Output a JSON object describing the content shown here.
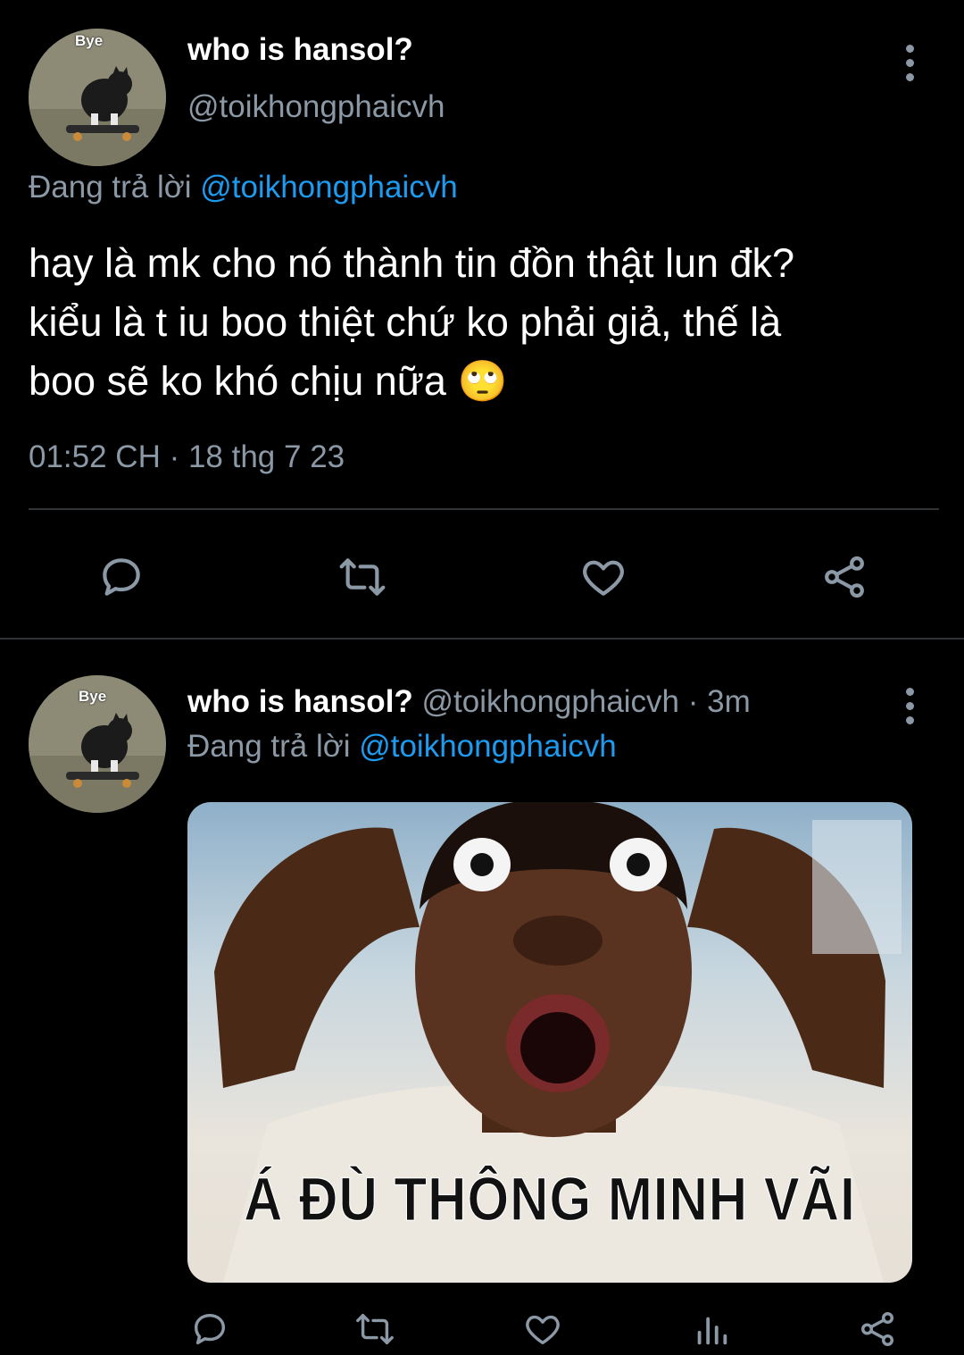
{
  "tweet": {
    "avatar_text": "Bye",
    "display_name": "who is hansol?",
    "handle": "@toikhongphaicvh",
    "replying_prefix": "Đang trả lời",
    "replying_handle": "@toikhongphaicvh",
    "text_line1": "hay là mk cho nó thành tin đồn thật lun đk?",
    "text_line2": "kiểu là t iu boo thiệt chứ ko phải giả, thế là",
    "text_line3": "boo sẽ ko khó chịu nữa",
    "emoji": "🙄",
    "timestamp": "01:52 CH · 18 thg 7 23"
  },
  "reply": {
    "avatar_text": "Bye",
    "display_name": "who is hansol?",
    "handle": "@toikhongphaicvh",
    "time_sep": "·",
    "time": "3m",
    "replying_prefix": "Đang trả lời",
    "replying_handle": "@toikhongphaicvh",
    "meme_caption": "Á ĐÙ THÔNG MINH VÃI"
  },
  "icons": [
    "reply-icon",
    "retweet-icon",
    "like-icon",
    "share-icon",
    "analytics-icon",
    "more-icon"
  ],
  "colors": {
    "background": "#000000",
    "muted": "#8b98a5",
    "link": "#1d9bf0",
    "divider": "#2f3336"
  }
}
